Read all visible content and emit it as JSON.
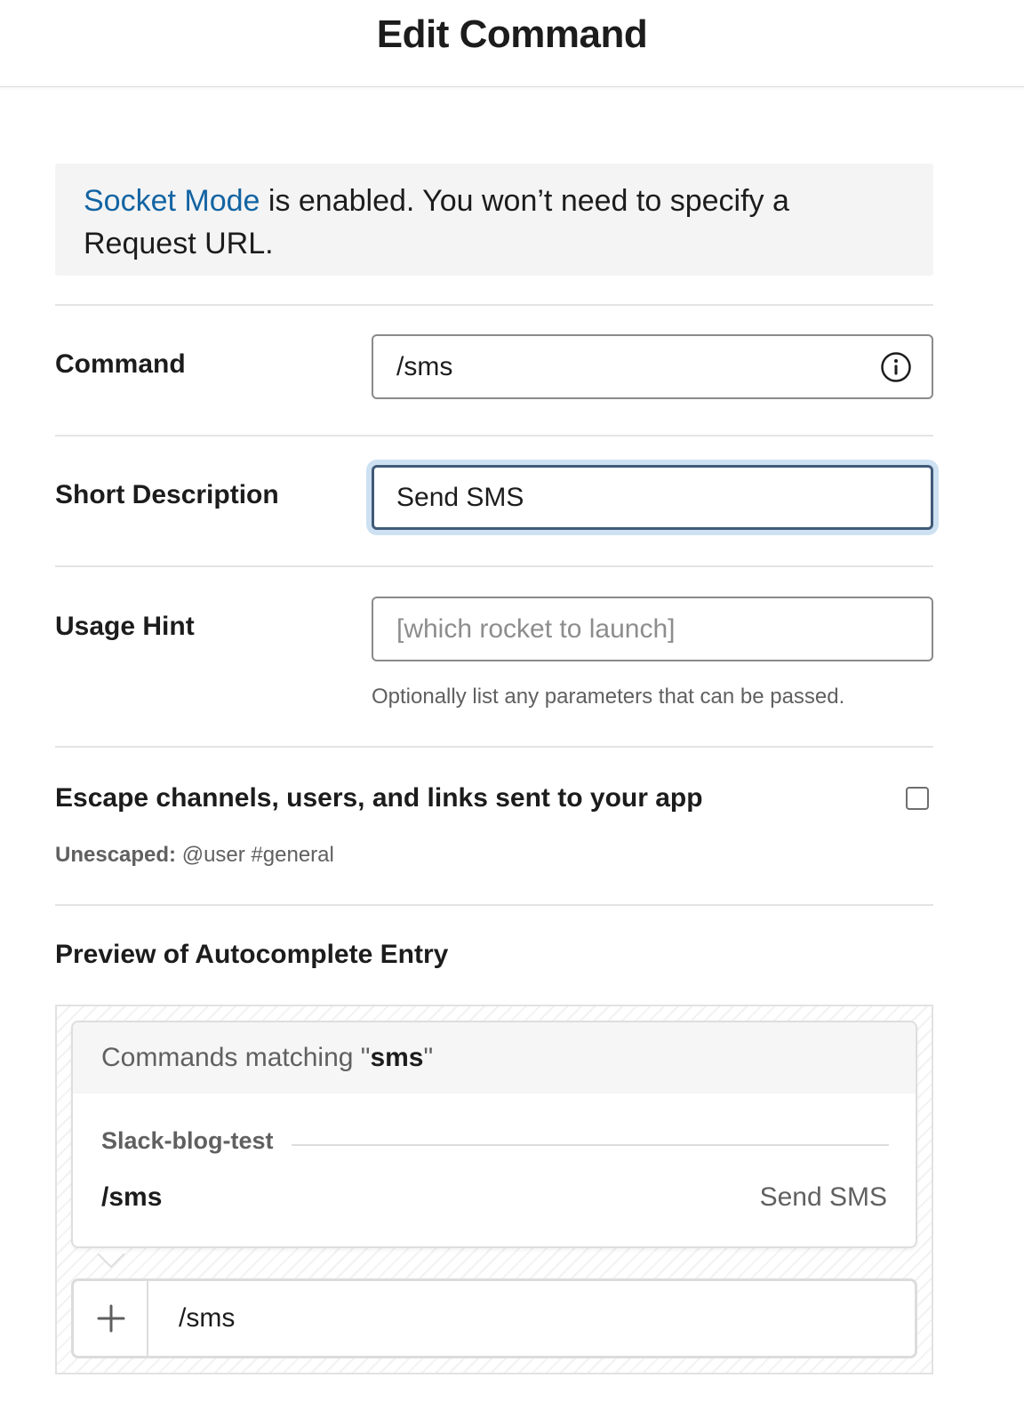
{
  "header": {
    "title": "Edit Command"
  },
  "notice": {
    "link_text": "Socket Mode",
    "line1_rest": " is enabled. You won’t need to specify a",
    "line2": "Request URL."
  },
  "form": {
    "command": {
      "label": "Command",
      "value": "/sms",
      "icon": "info-icon"
    },
    "short_description": {
      "label": "Short Description",
      "value": "Send SMS"
    },
    "usage_hint": {
      "label": "Usage Hint",
      "placeholder": "[which rocket to launch]",
      "helper": "Optionally list any parameters that can be passed."
    },
    "escape": {
      "label": "Escape channels, users, and links sent to your app",
      "checked": false,
      "unescaped_label": "Unescaped:",
      "unescaped_example": " @user #general"
    }
  },
  "preview": {
    "title": "Preview of Autocomplete Entry",
    "matching_prefix": "Commands matching \"",
    "matching_term": "sms",
    "matching_suffix": "\"",
    "app_name": "Slack-blog-test",
    "command": "/sms",
    "description": "Send SMS",
    "composer_icon": "plus-icon",
    "composer_text": "/sms"
  }
}
